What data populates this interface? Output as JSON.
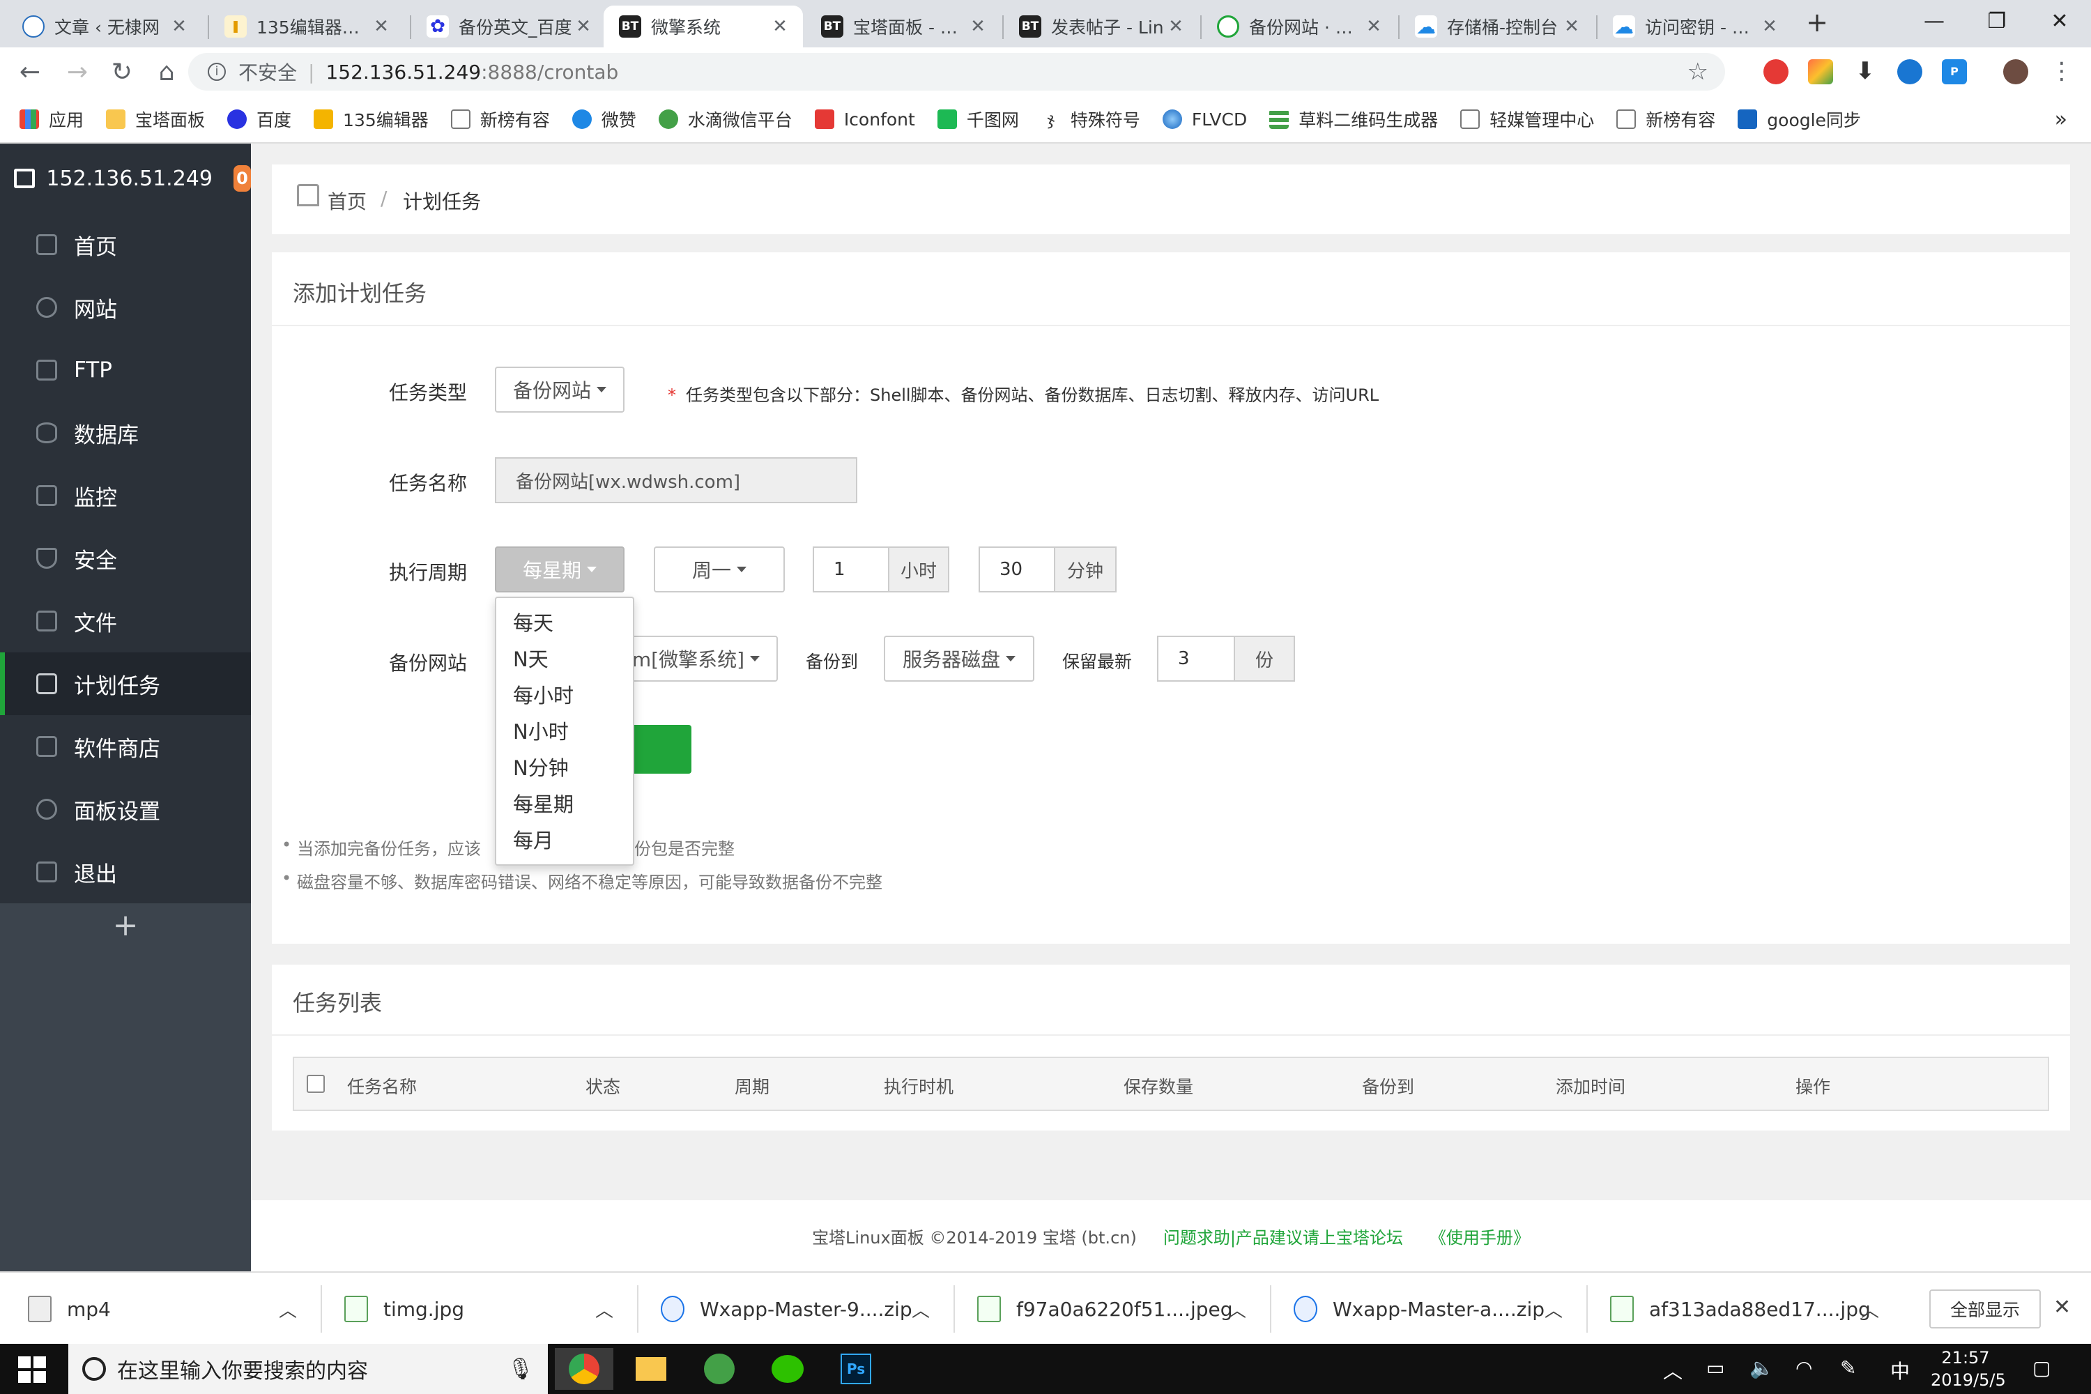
{
  "browser": {
    "tabs": [
      {
        "title": "文章 ‹ 无棣网",
        "active": false
      },
      {
        "title": "135编辑器官网",
        "active": false
      },
      {
        "title": "备份英文_百度",
        "active": false
      },
      {
        "title": "微擎系统",
        "active": true
      },
      {
        "title": "宝塔面板 - 简单",
        "active": false
      },
      {
        "title": "发表帖子 - Lin",
        "active": false
      },
      {
        "title": "备份网站 · 宝塔",
        "active": false
      },
      {
        "title": "存储桶-控制台",
        "active": false
      },
      {
        "title": "访问密钥 - 控制",
        "active": false
      }
    ],
    "new_tab": "+",
    "security_label": "不安全",
    "url_host": "152.136.51.249",
    "url_rest": ":8888/crontab",
    "bookmarks": [
      "应用",
      "宝塔面板",
      "百度",
      "135编辑器",
      "新榜有容",
      "微赞",
      "水滴微信平台",
      "Iconfont",
      "千图网",
      "特殊符号",
      "FLVCD",
      "草料二维码生成器",
      "轻媒管理中心",
      "新榜有容",
      "google同步"
    ],
    "bookmarks_more": "»"
  },
  "sidebar": {
    "server_ip": "152.136.51.249",
    "badge": "0",
    "items": [
      "首页",
      "网站",
      "FTP",
      "数据库",
      "监控",
      "安全",
      "文件",
      "计划任务",
      "软件商店",
      "面板设置",
      "退出"
    ],
    "add": "+"
  },
  "breadcrumb": {
    "home": "首页",
    "sep": "/",
    "current": "计划任务"
  },
  "add_task": {
    "title": "添加计划任务",
    "type_label": "任务类型",
    "type_value": "备份网站",
    "type_note_star": "*",
    "type_note": "任务类型包含以下部分：Shell脚本、备份网站、备份数据库、日志切割、释放内存、访问URL",
    "name_label": "任务名称",
    "name_value": "备份网站[wx.wdwsh.com]",
    "cycle_label": "执行周期",
    "cycle_value": "每星期",
    "weekday_value": "周一",
    "hour_value": "1",
    "hour_unit": "小时",
    "minute_value": "30",
    "minute_unit": "分钟",
    "backup_label": "备份网站",
    "backup_site_value": "m[微擎系统]",
    "backup_to_label": "备份到",
    "backup_to_value": "服务器磁盘",
    "keep_label": "保留最新",
    "keep_value": "3",
    "keep_unit": "份",
    "cycle_options": [
      "每天",
      "N天",
      "每小时",
      "N小时",
      "N分钟",
      "每星期",
      "每月"
    ],
    "tip1_a": "当添加完备份任务，应该",
    "tip1_b": "并检查备份包是否完整",
    "tip2": "磁盘容量不够、数据库密码错误、网络不稳定等原因，可能导致数据备份不完整"
  },
  "task_list": {
    "title": "任务列表",
    "columns": [
      "任务名称",
      "状态",
      "周期",
      "执行时机",
      "保存数量",
      "备份到",
      "添加时间",
      "操作"
    ]
  },
  "footer": {
    "copyright": "宝塔Linux面板 ©2014-2019 宝塔 (bt.cn)",
    "forum_link": "问题求助|产品建议请上宝塔论坛",
    "manual_link": "《使用手册》",
    "link_color": "#20a53a"
  },
  "downloads": {
    "items": [
      "mp4",
      "timg.jpg",
      "Wxapp-Master-9....zip",
      "f97a0a6220f51....jpeg",
      "Wxapp-Master-a....zip",
      "af313ada88ed17....jpg"
    ],
    "show_all": "全部显示",
    "close": "✕"
  },
  "taskbar": {
    "search_placeholder": "在这里输入你要搜索的内容",
    "ime": "中",
    "time": "21:57",
    "date": "2019/5/5"
  },
  "colors": {
    "accent_green": "#20a53a",
    "sidebar_bg": "#2b3139",
    "badge": "#f0813a"
  }
}
